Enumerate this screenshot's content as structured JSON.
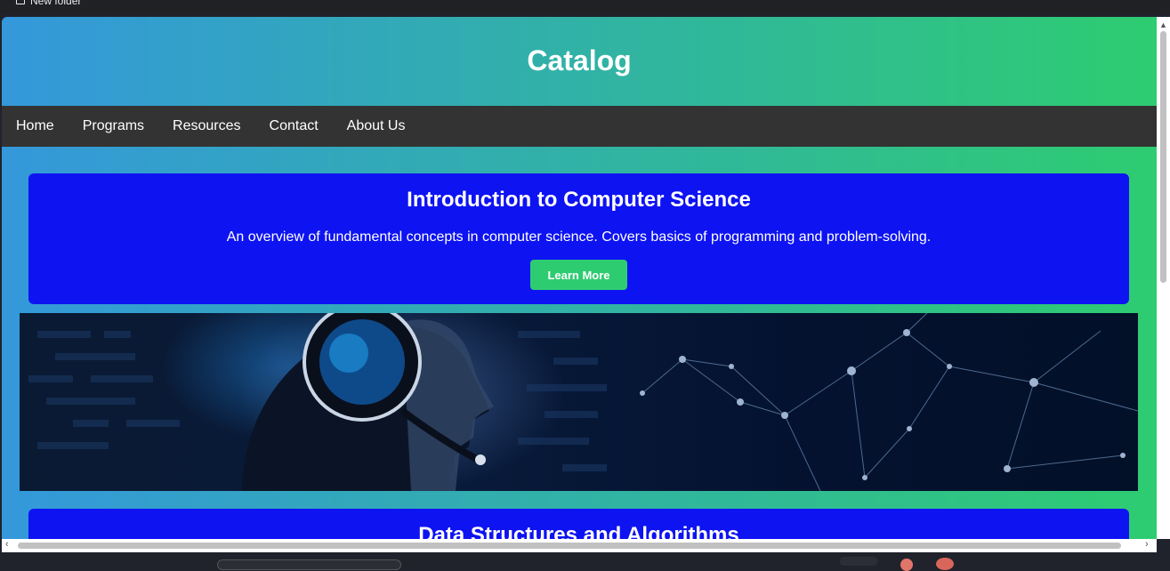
{
  "bookmarks": {
    "items": [
      {
        "label": "New folder",
        "icon": "folder-icon"
      }
    ]
  },
  "site": {
    "title": "Catalog"
  },
  "nav": {
    "items": [
      "Home",
      "Programs",
      "Resources",
      "Contact",
      "About Us"
    ]
  },
  "courses": [
    {
      "title": "Introduction to Computer Science",
      "description": "An overview of fundamental concepts in computer science. Covers basics of programming and problem-solving.",
      "button_label": "Learn More"
    },
    {
      "title": "Data Structures and Algorithms"
    }
  ],
  "banner": {
    "alt": "person with headset and network graphic"
  },
  "colors": {
    "header_gradient_start": "#3498db",
    "header_gradient_end": "#2ecc71",
    "nav_bg": "#333333",
    "card_bg": "#0e13f2",
    "button_bg": "#2ecc71"
  }
}
